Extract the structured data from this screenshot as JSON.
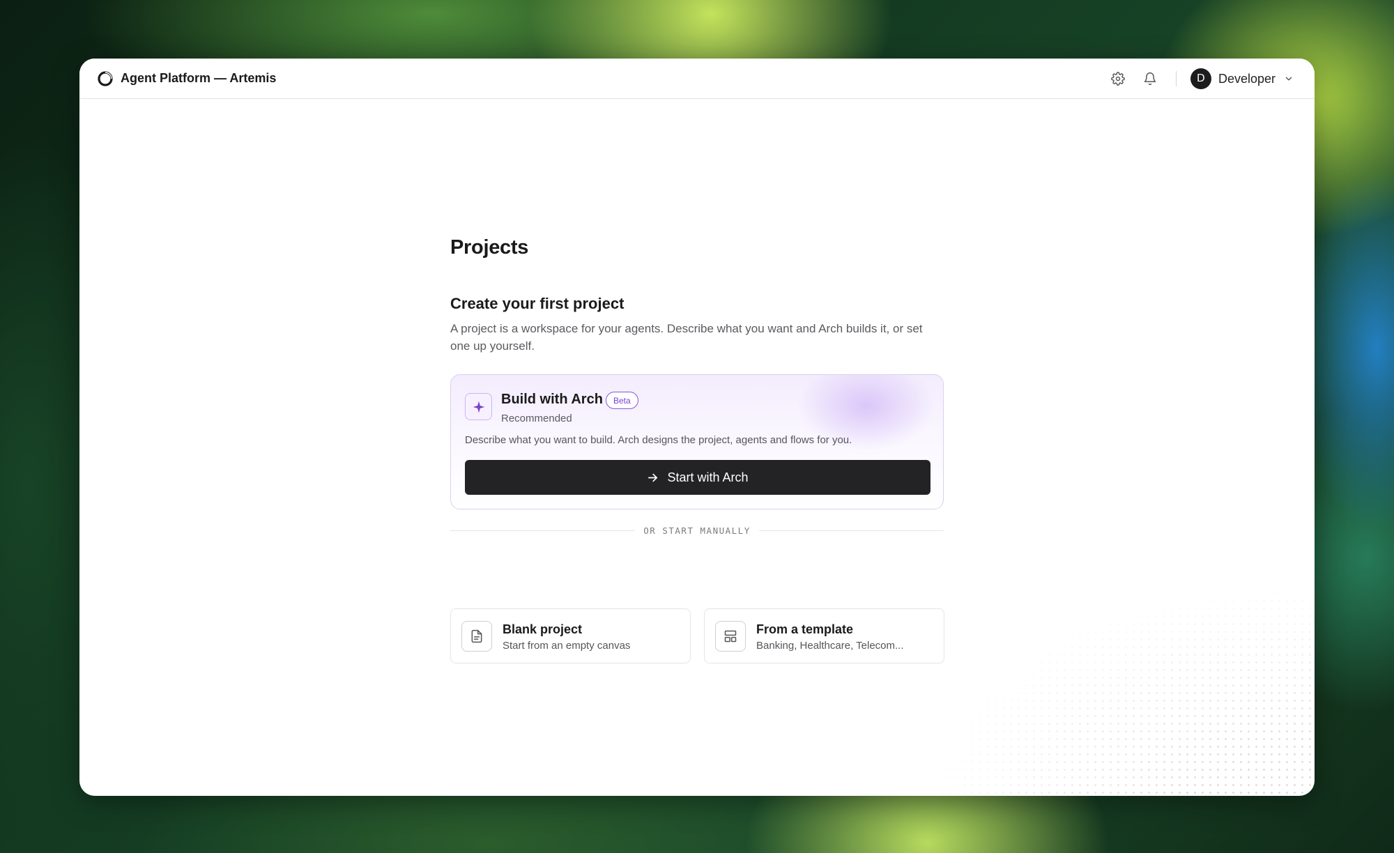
{
  "app": {
    "title": "Agent Platform — Artemis"
  },
  "topbar": {
    "icons": [
      "settings-icon",
      "bell-icon",
      "chevron-down-icon"
    ],
    "user": {
      "initial": "D",
      "name": "Developer"
    }
  },
  "main": {
    "page_title": "Projects",
    "section_title": "Create your first project",
    "section_description": "A project is a workspace for your agents. Describe what you want and Arch builds it, or set one up yourself.",
    "arch_card": {
      "title": "Build with Arch",
      "badge": "Beta",
      "subtitle": "Recommended",
      "description": "Describe what you want to build. Arch designs the project, agents and flows for you.",
      "button_label": "Start with Arch",
      "icon": "sparkle-icon"
    },
    "divider_label": "OR START MANUALLY",
    "options": [
      {
        "title": "Blank project",
        "subtitle": "Start from an empty canvas",
        "icon": "document-icon"
      },
      {
        "title": "From a template",
        "subtitle": "Banking, Healthcare, Telecom...",
        "icon": "template-icon"
      }
    ]
  },
  "colors": {
    "accent_purple": "#7a3fd0",
    "primary_button": "#232326",
    "border": "#e5e5e9"
  }
}
